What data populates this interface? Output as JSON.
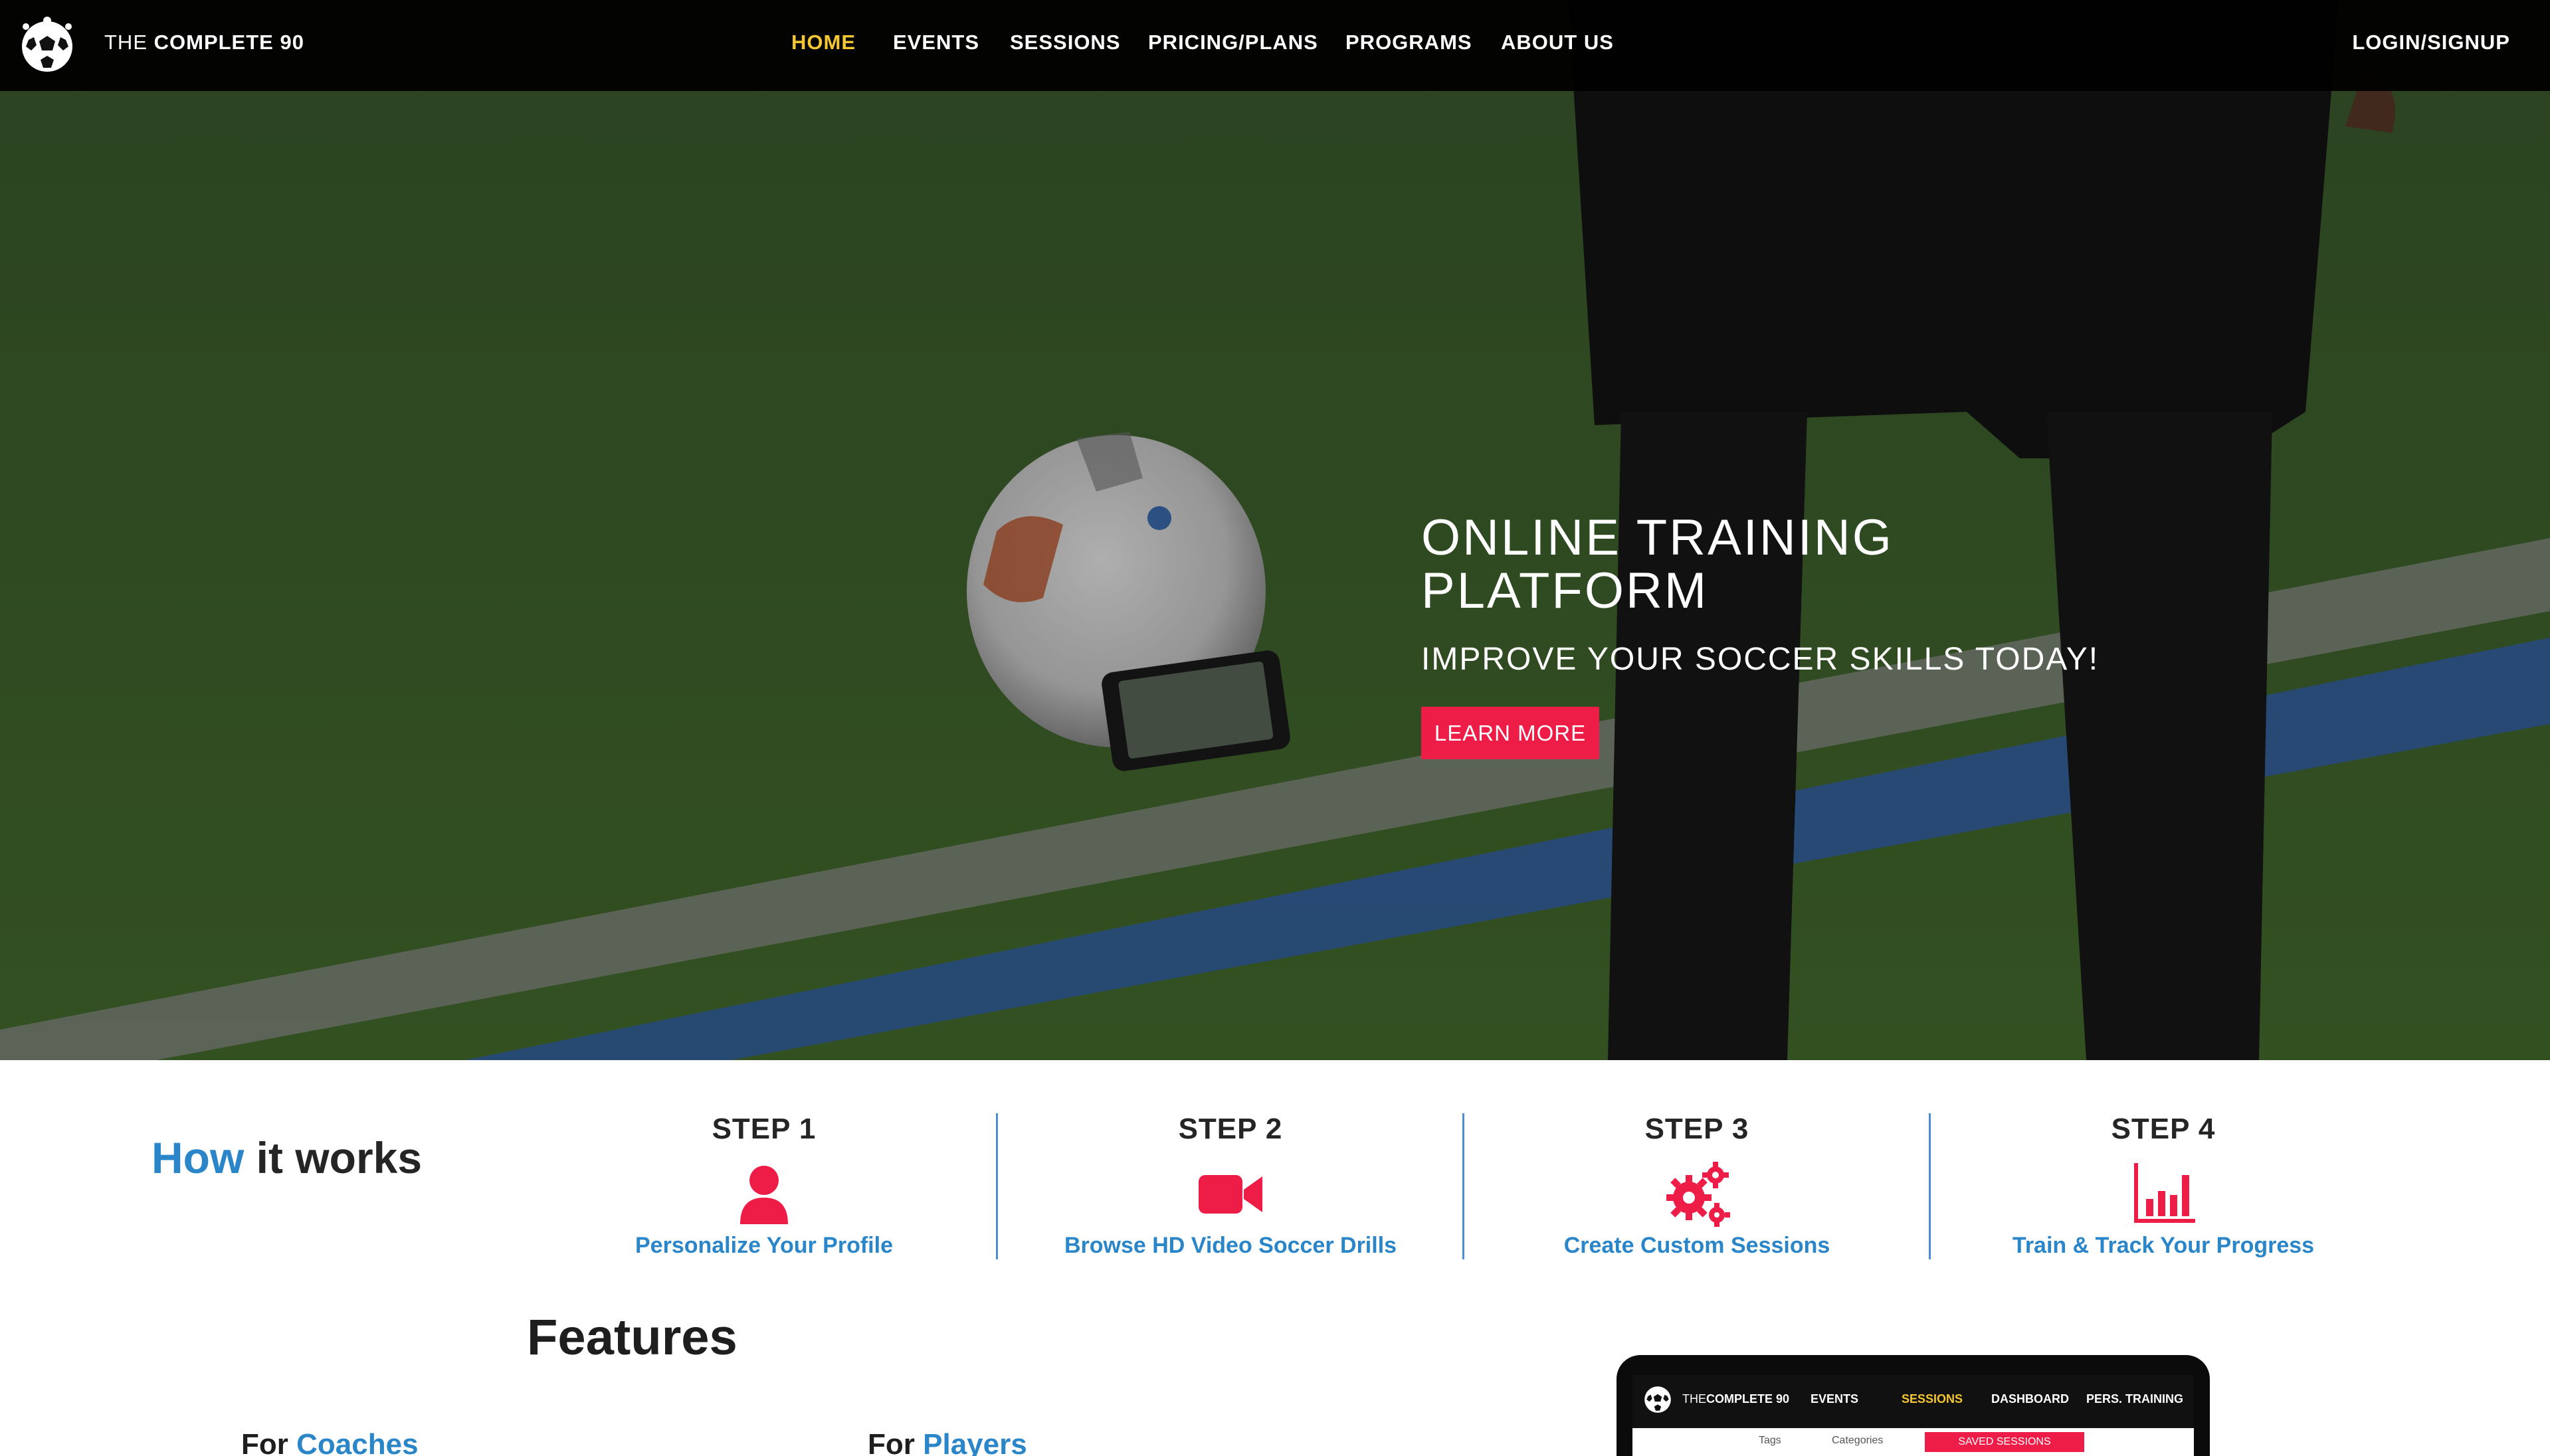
{
  "brand": {
    "prefix": "THE",
    "name": "COMPLETE 90"
  },
  "nav": {
    "items": [
      {
        "label": "HOME",
        "active": true
      },
      {
        "label": "EVENTS",
        "active": false
      },
      {
        "label": "SESSIONS",
        "active": false
      },
      {
        "label": "PRICING/PLANS",
        "active": false
      },
      {
        "label": "PROGRAMS",
        "active": false
      },
      {
        "label": "ABOUT US",
        "active": false
      }
    ],
    "login": "LOGIN/SIGNUP"
  },
  "hero": {
    "title": "ONLINE TRAINING PLATFORM",
    "subtitle": "IMPROVE YOUR SOCCER SKILLS TODAY!",
    "cta": "LEARN MORE"
  },
  "how_it_works": {
    "accent": "How",
    "rest": "it works",
    "steps": [
      {
        "title": "STEP 1",
        "icon": "user-icon",
        "description": "Personalize Your Profile"
      },
      {
        "title": "STEP 2",
        "icon": "video-camera-icon",
        "description": "Browse HD Video Soccer Drills"
      },
      {
        "title": "STEP 3",
        "icon": "gears-icon",
        "description": "Create Custom Sessions"
      },
      {
        "title": "STEP 4",
        "icon": "bar-chart-icon",
        "description": "Train & Track Your Progress"
      }
    ]
  },
  "features": {
    "title": "Features",
    "coaches": {
      "prefix": "For",
      "accent": "Coaches"
    },
    "players": {
      "prefix": "For",
      "accent": "Players"
    }
  },
  "device_preview": {
    "brand_prefix": "THE",
    "brand_name": "COMPLETE 90",
    "items": [
      "EVENTS",
      "SESSIONS",
      "DASHBOARD",
      "PERS. TRAINING"
    ],
    "active_item": "SESSIONS",
    "labels": [
      "Tags",
      "Categories"
    ],
    "button": "SAVED SESSIONS"
  },
  "colors": {
    "accent_blue": "#2a86c8",
    "accent_red": "#ee1d48",
    "nav_active": "#f4c631",
    "nav_bg": "#000000"
  }
}
